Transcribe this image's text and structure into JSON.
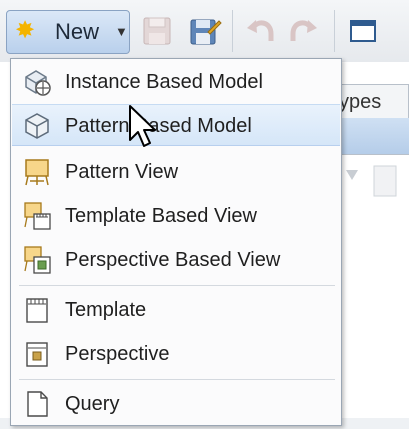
{
  "toolbar": {
    "new_label": "New",
    "icons": [
      "new-star-icon",
      "save-icon",
      "save-as-icon",
      "undo-icon",
      "redo-icon",
      "window-icon"
    ]
  },
  "background": {
    "tab_label": "ypes"
  },
  "menu": {
    "items": [
      {
        "label": "Instance Based Model",
        "icon": "instance-model-icon"
      },
      {
        "label": "Pattern Based Model",
        "icon": "pattern-model-icon"
      },
      {
        "label": "Pattern View",
        "icon": "pattern-view-icon"
      },
      {
        "label": "Template Based View",
        "icon": "template-view-icon"
      },
      {
        "label": "Perspective Based View",
        "icon": "perspective-view-icon"
      },
      {
        "label": "Template",
        "icon": "template-icon"
      },
      {
        "label": "Perspective",
        "icon": "perspective-icon"
      },
      {
        "label": "Query",
        "icon": "query-icon"
      }
    ],
    "highlighted_item": "Pattern Based Model"
  },
  "colors": {
    "highlight": "#d5e6f8",
    "accent": "#f4b400"
  }
}
